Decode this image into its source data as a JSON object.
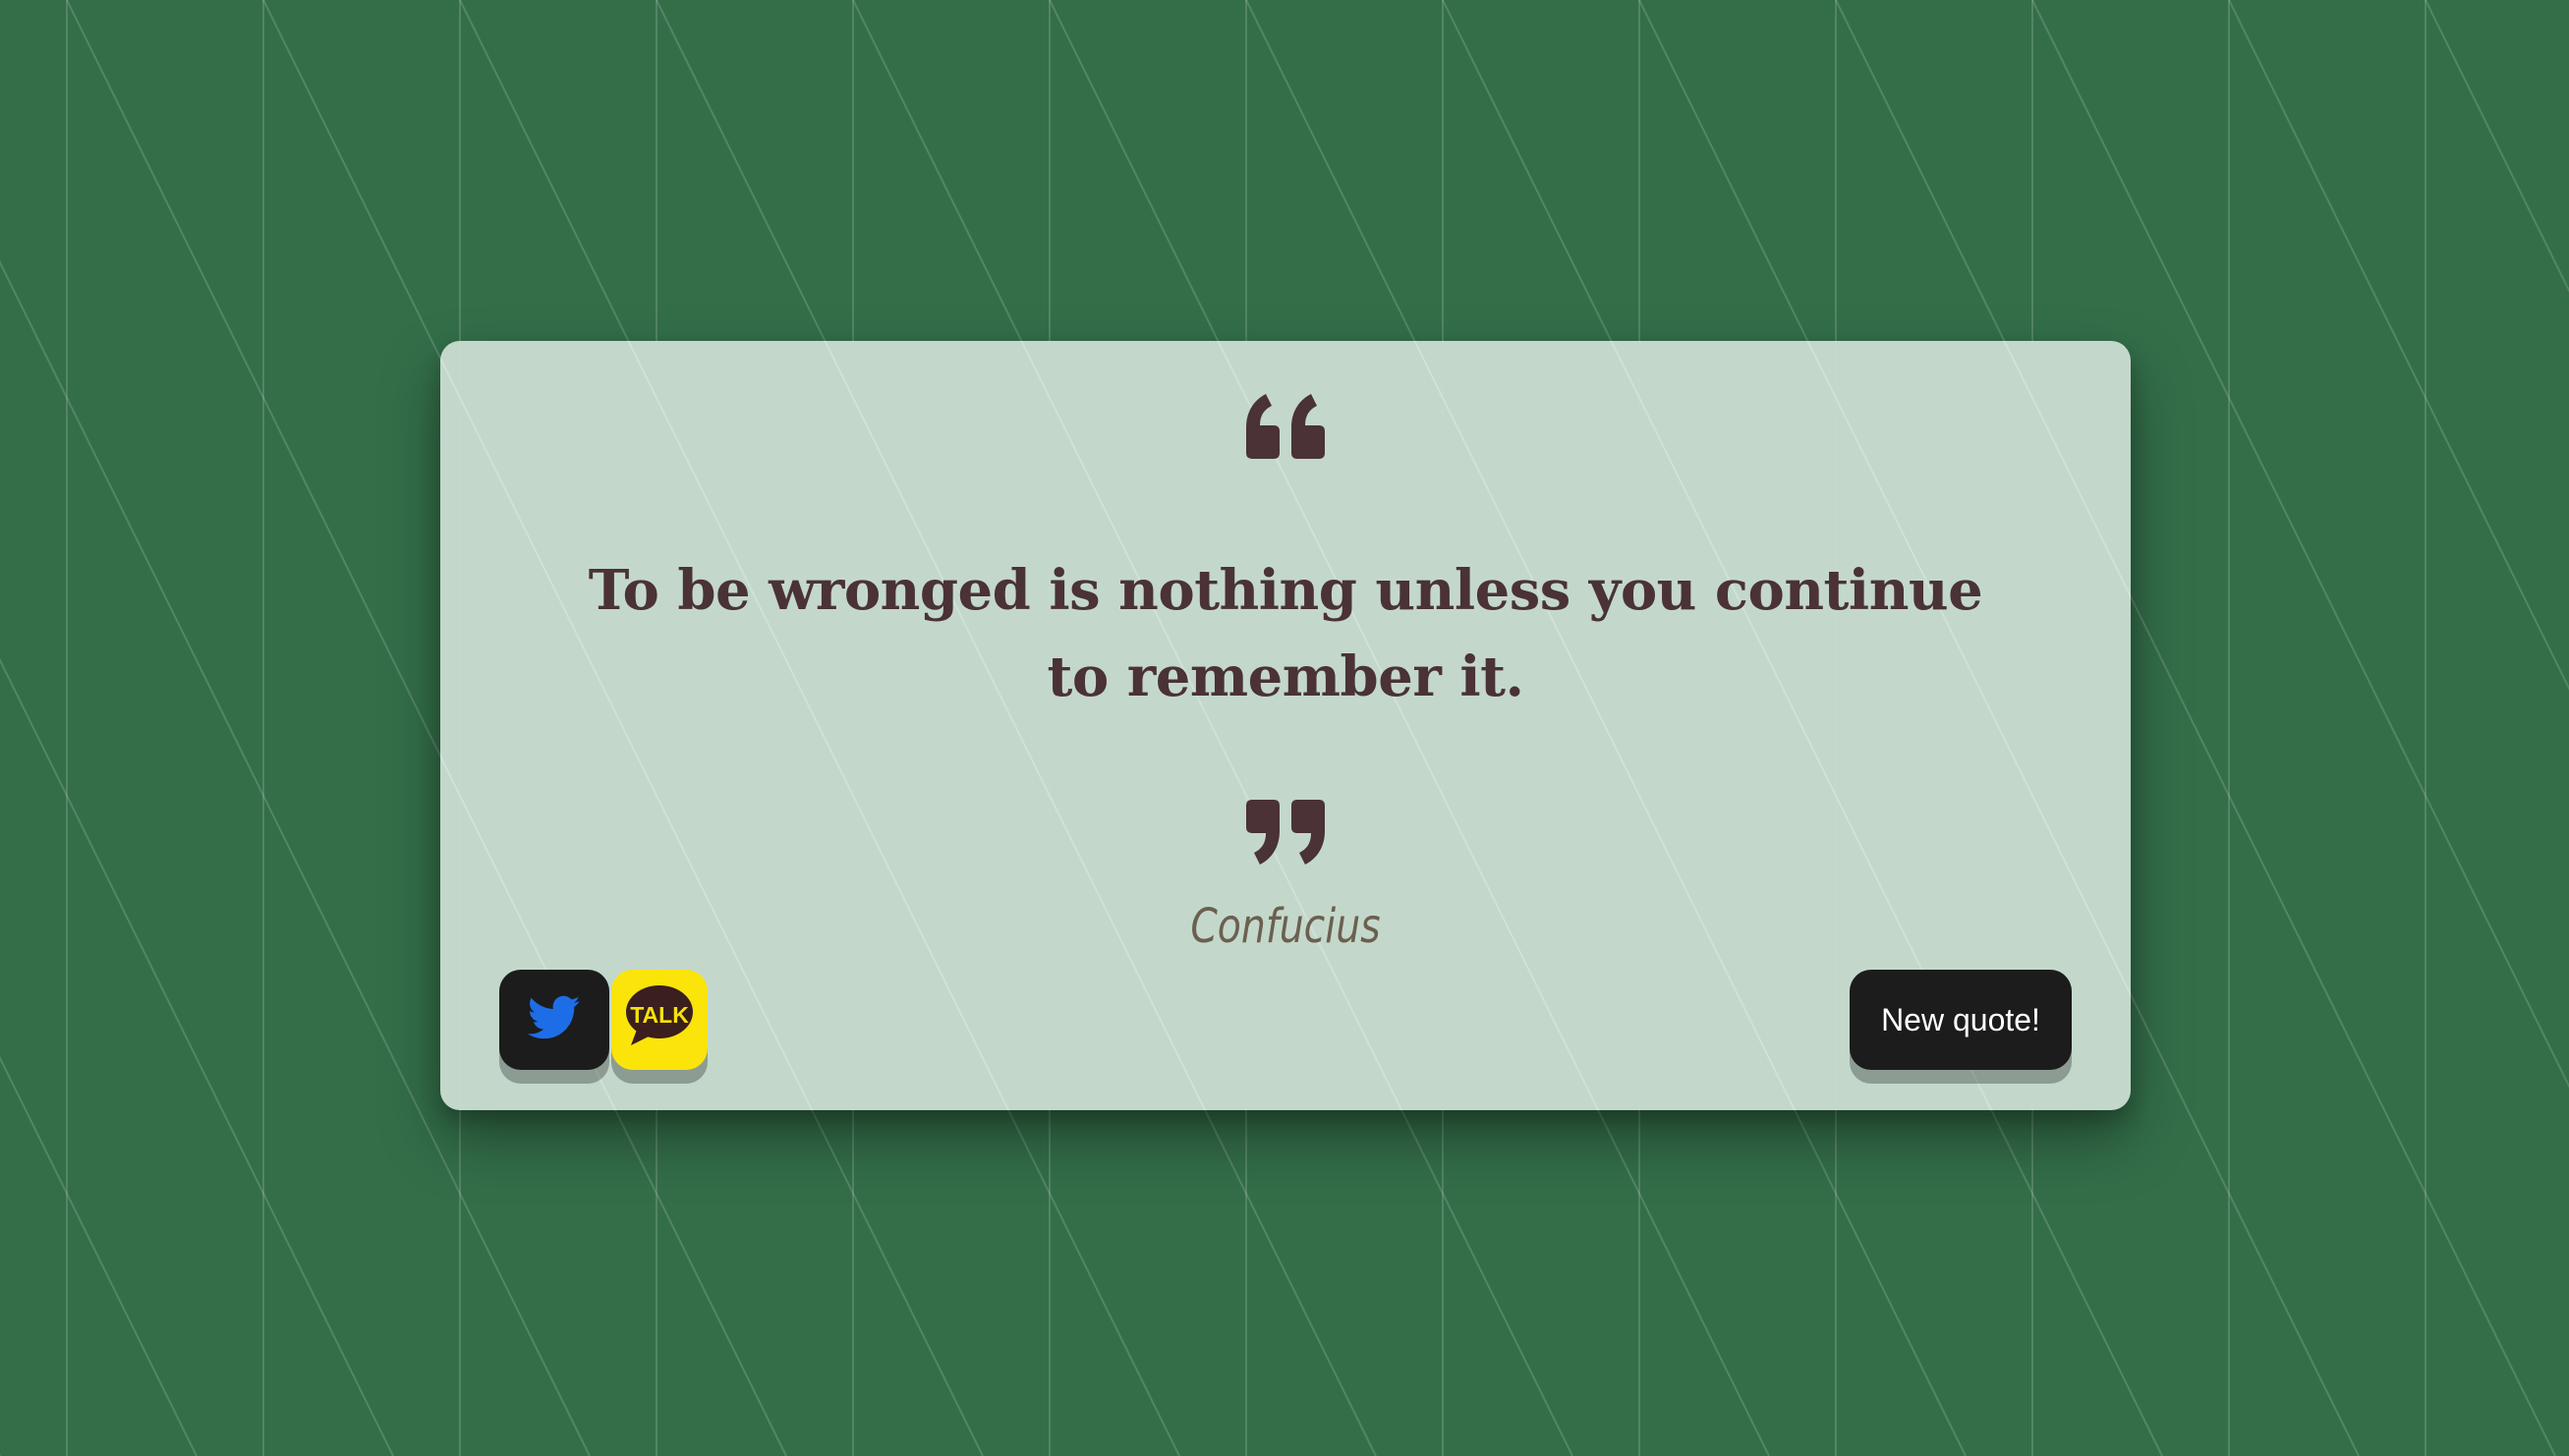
{
  "colors": {
    "background": "#336e49",
    "card": "#c8dccf",
    "quote_text": "#4a3236",
    "author_text": "#6b604f",
    "button_dark": "#1c1c1c",
    "twitter_blue": "#1d6ee6",
    "kakao_yellow": "#fbe40a"
  },
  "quote": {
    "open_icon": "quote-open-icon",
    "text": "To be wronged is nothing unless you continue to remember it.",
    "close_icon": "quote-close-icon",
    "author": "Confucius"
  },
  "actions": {
    "twitter_icon": "twitter-bird-icon",
    "kakao_icon": "kakaotalk-icon",
    "kakao_label": "TALK",
    "new_quote_label": "New quote!"
  }
}
